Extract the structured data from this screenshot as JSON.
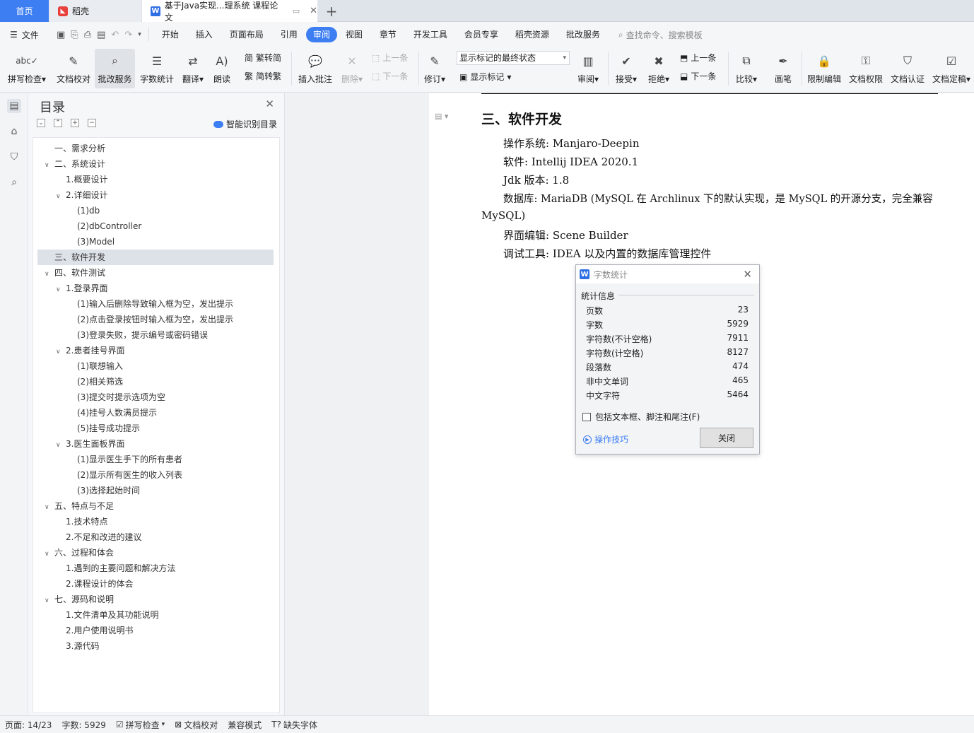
{
  "tabs": {
    "home": "首页",
    "docer": "稻壳",
    "doc": "基于Java实现...理系统 课程论文"
  },
  "menu": {
    "file": "文件",
    "items": [
      "开始",
      "插入",
      "页面布局",
      "引用",
      "审阅",
      "视图",
      "章节",
      "开发工具",
      "会员专享",
      "稻壳资源",
      "批改服务"
    ],
    "active": "审阅",
    "search": "查找命令、搜索模板"
  },
  "ribbon": {
    "spell": "拼写检查",
    "proof": "文档校对",
    "grade": "批改服务",
    "wordcount": "字数统计",
    "translate": "翻译",
    "read": "朗读",
    "trad": "繁转简",
    "simp": "简转繁",
    "insert_comment": "插入批注",
    "delete": "删除",
    "prev_comment": "上一条",
    "next_comment": "下一条",
    "track": "修订",
    "markup_state": "显示标记的最终状态",
    "show_markup": "显示标记",
    "review": "审阅",
    "accept": "接受",
    "reject": "拒绝",
    "prev": "上一条",
    "next": "下一条",
    "compare": "比较",
    "pen": "画笔",
    "restrict": "限制编辑",
    "permission": "文档权限",
    "certify": "文档认证",
    "finalize": "文档定稿"
  },
  "toc": {
    "title": "目录",
    "smart": "智能识别目录",
    "items": [
      {
        "text": "一、需求分析",
        "level": 0,
        "chev": ""
      },
      {
        "text": "二、系统设计",
        "level": 0,
        "chev": "v"
      },
      {
        "text": "1.概要设计",
        "level": 1,
        "chev": ""
      },
      {
        "text": "2.详细设计",
        "level": 1,
        "chev": "v"
      },
      {
        "text": "(1)db",
        "level": 2,
        "chev": ""
      },
      {
        "text": "(2)dbController",
        "level": 2,
        "chev": ""
      },
      {
        "text": "(3)Model",
        "level": 2,
        "chev": ""
      },
      {
        "text": "三、软件开发",
        "level": 0,
        "chev": "",
        "selected": true
      },
      {
        "text": "四、软件测试",
        "level": 0,
        "chev": "v"
      },
      {
        "text": "1.登录界面",
        "level": 1,
        "chev": "v"
      },
      {
        "text": "(1)输入后删除导致输入框为空，发出提示",
        "level": 2,
        "chev": ""
      },
      {
        "text": "(2)点击登录按钮时输入框为空，发出提示",
        "level": 2,
        "chev": ""
      },
      {
        "text": "(3)登录失败，提示编号或密码错误",
        "level": 2,
        "chev": ""
      },
      {
        "text": "2.患者挂号界面",
        "level": 1,
        "chev": "v"
      },
      {
        "text": "(1)联想输入",
        "level": 2,
        "chev": ""
      },
      {
        "text": "(2)相关筛选",
        "level": 2,
        "chev": ""
      },
      {
        "text": "(3)提交时提示选项为空",
        "level": 2,
        "chev": ""
      },
      {
        "text": "(4)挂号人数满员提示",
        "level": 2,
        "chev": ""
      },
      {
        "text": "(5)挂号成功提示",
        "level": 2,
        "chev": ""
      },
      {
        "text": "3.医生面板界面",
        "level": 1,
        "chev": "v"
      },
      {
        "text": "(1)显示医生手下的所有患者",
        "level": 2,
        "chev": ""
      },
      {
        "text": "(2)显示所有医生的收入列表",
        "level": 2,
        "chev": ""
      },
      {
        "text": "(3)选择起始时间",
        "level": 2,
        "chev": ""
      },
      {
        "text": "五、特点与不足",
        "level": 0,
        "chev": "v"
      },
      {
        "text": "1.技术特点",
        "level": 1,
        "chev": ""
      },
      {
        "text": "2.不足和改进的建议",
        "level": 1,
        "chev": ""
      },
      {
        "text": "六、过程和体会",
        "level": 0,
        "chev": "v"
      },
      {
        "text": "1.遇到的主要问题和解决方法",
        "level": 1,
        "chev": ""
      },
      {
        "text": "2.课程设计的体会",
        "level": 1,
        "chev": ""
      },
      {
        "text": "七、源码和说明",
        "level": 0,
        "chev": "v"
      },
      {
        "text": "1.文件清单及其功能说明",
        "level": 1,
        "chev": ""
      },
      {
        "text": "2.用户使用说明书",
        "level": 1,
        "chev": ""
      },
      {
        "text": "3.源代码",
        "level": 1,
        "chev": ""
      }
    ]
  },
  "doc": {
    "heading": "三、软件开发",
    "line1": "操作系统: Manjaro-Deepin",
    "line2": "软件: Intellij IDEA 2020.1",
    "line3": "Jdk 版本: 1.8",
    "line4": "数据库: MariaDB (MySQL 在 Archlinux 下的默认实现，是 MySQL 的开源分支，完全兼容",
    "line4b": "MySQL)",
    "line5": "界面编辑: Scene Builder",
    "line6": "调试工具: IDEA 以及内置的数据库管理控件"
  },
  "dialog": {
    "title": "字数统计",
    "group": "统计信息",
    "stats": [
      {
        "label": "页数",
        "value": "23"
      },
      {
        "label": "字数",
        "value": "5929"
      },
      {
        "label": "字符数(不计空格)",
        "value": "7911"
      },
      {
        "label": "字符数(计空格)",
        "value": "8127"
      },
      {
        "label": "段落数",
        "value": "474"
      },
      {
        "label": "非中文单词",
        "value": "465"
      },
      {
        "label": "中文字符",
        "value": "5464"
      }
    ],
    "checkbox": "包括文本框、脚注和尾注(F)",
    "tips": "操作技巧",
    "close": "关闭"
  },
  "status": {
    "page": "页面: 14/23",
    "words": "字数: 5929",
    "spell": "拼写检查",
    "proof": "文档校对",
    "compat": "兼容模式",
    "missing_font": "缺失字体"
  },
  "colors": {
    "accent": "#3d7ef3",
    "docer": "#e8403c"
  }
}
